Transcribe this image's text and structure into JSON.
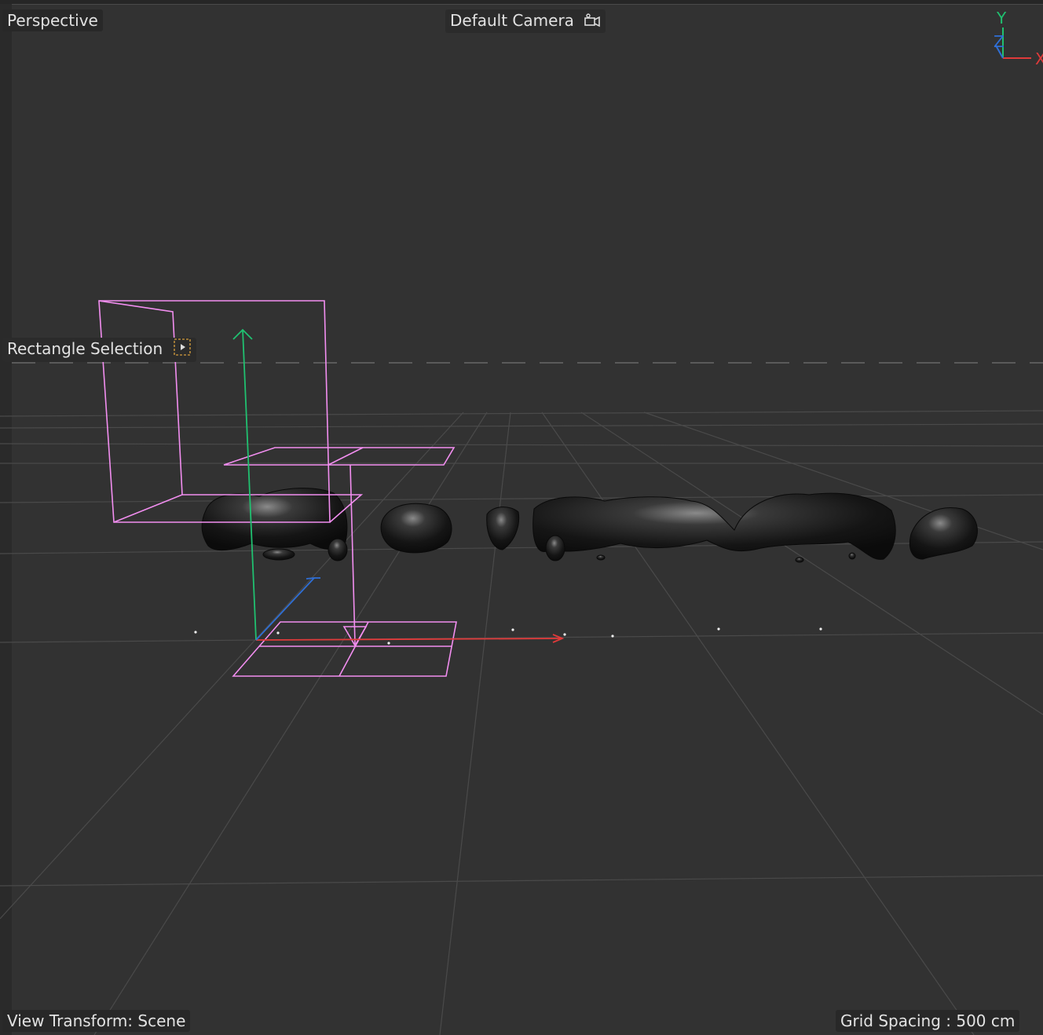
{
  "viewport": {
    "projection_label": "Perspective",
    "camera_label": "Default Camera",
    "camera_icon": "camera-icon",
    "tool_label": "Rectangle Selection",
    "tool_icon": "rectangle-selection-icon",
    "view_transform_label": "View Transform: Scene",
    "grid_spacing_label": "Grid Spacing : 500 cm"
  },
  "orientation_gizmo": {
    "y_label": "Y",
    "z_label": "Z",
    "x_label": "X"
  },
  "colors": {
    "background": "#323232",
    "grid_line": "#4a4a4a",
    "x_axis": "#e03a3a",
    "y_axis": "#20c070",
    "z_axis": "#2f6fd6",
    "selection_wireframe": "#f28ef0",
    "fluid_mesh": "#1a1a1a"
  }
}
